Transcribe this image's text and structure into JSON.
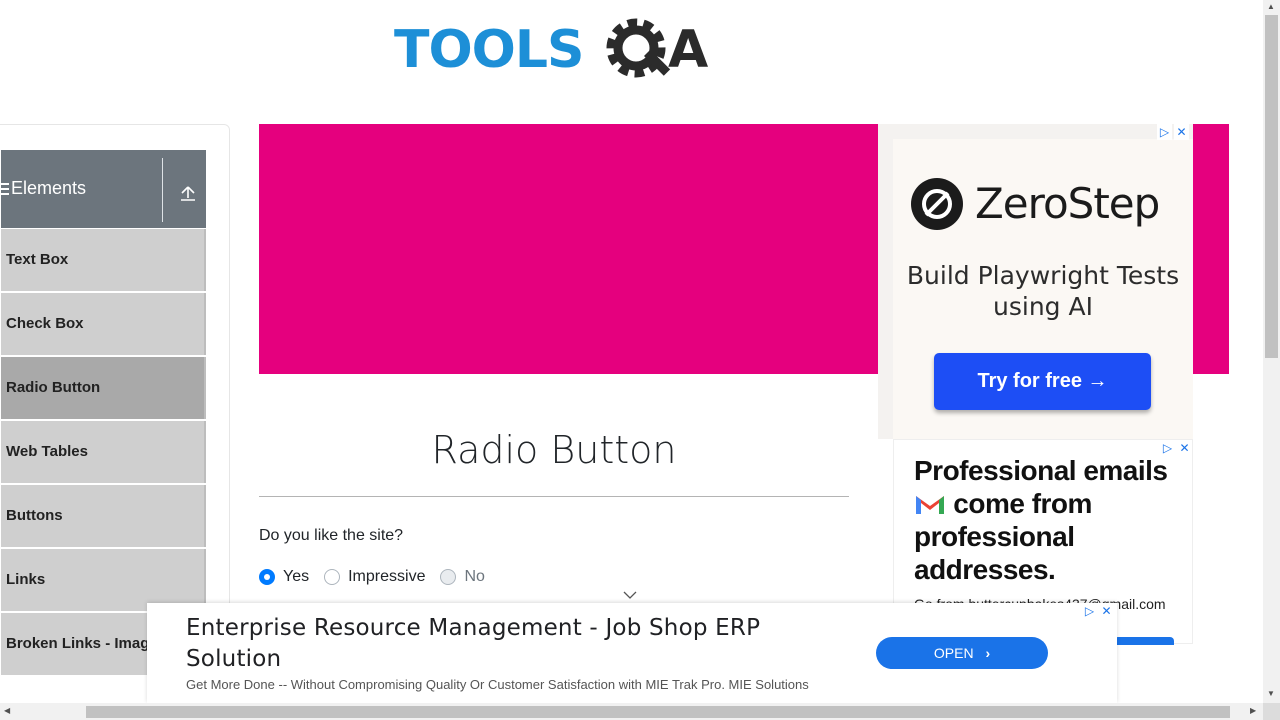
{
  "logo": {
    "text_left": "TOOLS",
    "text_right": "A"
  },
  "sidebar": {
    "group_title": "Elements",
    "items": [
      {
        "label": "Text Box",
        "active": false
      },
      {
        "label": "Check Box",
        "active": false
      },
      {
        "label": "Radio Button",
        "active": true
      },
      {
        "label": "Web Tables",
        "active": false
      },
      {
        "label": "Buttons",
        "active": false
      },
      {
        "label": "Links",
        "active": false
      },
      {
        "label": "Broken Links - Images",
        "active": false
      }
    ]
  },
  "banner": {
    "color": "#e5007e"
  },
  "main": {
    "title": "Radio Button",
    "question": "Do you like the site?",
    "options": [
      {
        "label": "Yes",
        "checked": true,
        "disabled": false
      },
      {
        "label": "Impressive",
        "checked": false,
        "disabled": false
      },
      {
        "label": "No",
        "checked": false,
        "disabled": true
      }
    ]
  },
  "ad_right": {
    "brand": "ZeroStep",
    "tagline": "Build Playwright Tests using AI",
    "cta": "Try for free →",
    "second_headline_1": "Professional emails",
    "second_headline_2": " come from professional addresses.",
    "second_domain": "Go from buttercupbakes437@gmail.com",
    "choices_play": "▷",
    "choices_close": "✕"
  },
  "bottom_ad": {
    "title": "Enterprise Resource Management - Job Shop ERP Solution",
    "description": "Get More Done -- Without Compromising Quality Or Customer Satisfaction with MIE Trak Pro. MIE Solutions",
    "button": "OPEN",
    "button_chevron": "›",
    "choices_play": "▷",
    "choices_close": "✕"
  },
  "scroll": {
    "up": "▲",
    "down": "▼",
    "left": "◀",
    "right": "▶"
  }
}
